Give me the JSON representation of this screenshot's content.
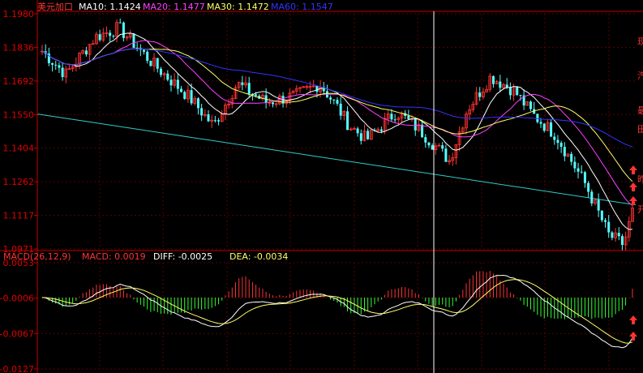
{
  "colors": {
    "background": "#000000",
    "axis": "#c00000",
    "grid": "#5a0000",
    "tick_text": "#e00000",
    "up_candle": "#ff3333",
    "down_candle": "#54ffff",
    "ma10": "#ffffff",
    "ma20": "#ff40ff",
    "ma30": "#ffff66",
    "ma60": "#3333ff",
    "trendline": "#33cccc",
    "cursor": "#ffffff",
    "macd_pos": "#ff3333",
    "macd_neg": "#33ff33",
    "diff": "#ffffff",
    "dea": "#ffff66",
    "marker": "#ff3333"
  },
  "price_header": {
    "symbol": "美元加口",
    "ma10_label": "MA10: 1.1424",
    "ma20_label": "MA20: 1.1477",
    "ma30_label": "MA30: 1.1472",
    "ma60_label": "MA60: 1.1547"
  },
  "macd_header": {
    "title": "MACD(26,12,9)",
    "macd_label": "MACD: 0.0019",
    "diff_label": "DIFF: -0.0025",
    "dea_label": "DEA: -0.0034"
  },
  "right_edge_glyphs": [
    "现",
    "汽",
    "最",
    "田",
    "昨",
    "开"
  ],
  "chart_data": [
    {
      "type": "candlestick",
      "title": "美元加口",
      "y_ticks": [
        "1.1980",
        "1.1836",
        "1.1692",
        "1.1550",
        "1.1404",
        "1.1262",
        "1.1117",
        "1.0971"
      ],
      "ylim": [
        1.0971,
        1.198
      ],
      "grid": true,
      "series": [
        {
          "name": "MA10",
          "value": 1.1424
        },
        {
          "name": "MA20",
          "value": 1.1477
        },
        {
          "name": "MA30",
          "value": 1.1472
        },
        {
          "name": "MA60",
          "value": 1.1547
        }
      ],
      "trendline": {
        "start": 1.155,
        "end": 1.116
      },
      "keypoints": [
        {
          "x": 0,
          "y": 1.182
        },
        {
          "x": 0.04,
          "y": 1.172
        },
        {
          "x": 0.09,
          "y": 1.188
        },
        {
          "x": 0.13,
          "y": 1.192
        },
        {
          "x": 0.19,
          "y": 1.176
        },
        {
          "x": 0.25,
          "y": 1.162
        },
        {
          "x": 0.29,
          "y": 1.15
        },
        {
          "x": 0.33,
          "y": 1.168
        },
        {
          "x": 0.38,
          "y": 1.16
        },
        {
          "x": 0.43,
          "y": 1.163
        },
        {
          "x": 0.47,
          "y": 1.168
        },
        {
          "x": 0.5,
          "y": 1.158
        },
        {
          "x": 0.52,
          "y": 1.15
        },
        {
          "x": 0.55,
          "y": 1.144
        },
        {
          "x": 0.6,
          "y": 1.156
        },
        {
          "x": 0.64,
          "y": 1.148
        },
        {
          "x": 0.69,
          "y": 1.135
        },
        {
          "x": 0.72,
          "y": 1.157
        },
        {
          "x": 0.76,
          "y": 1.171
        },
        {
          "x": 0.8,
          "y": 1.165
        },
        {
          "x": 0.83,
          "y": 1.155
        },
        {
          "x": 0.87,
          "y": 1.146
        },
        {
          "x": 0.92,
          "y": 1.125
        },
        {
          "x": 0.96,
          "y": 1.103
        },
        {
          "x": 0.985,
          "y": 1.099
        },
        {
          "x": 1.0,
          "y": 1.113
        }
      ]
    },
    {
      "type": "bar",
      "title": "MACD(26,12,9)",
      "y_ticks": [
        "0.0053",
        "-0.0006",
        "-0.0067",
        "-0.0127"
      ],
      "ylim": [
        -0.0127,
        0.0053
      ],
      "grid": true,
      "series": [
        {
          "name": "MACD",
          "value": 0.0019
        },
        {
          "name": "DIFF",
          "value": -0.0025
        },
        {
          "name": "DEA",
          "value": -0.0034
        }
      ]
    }
  ]
}
